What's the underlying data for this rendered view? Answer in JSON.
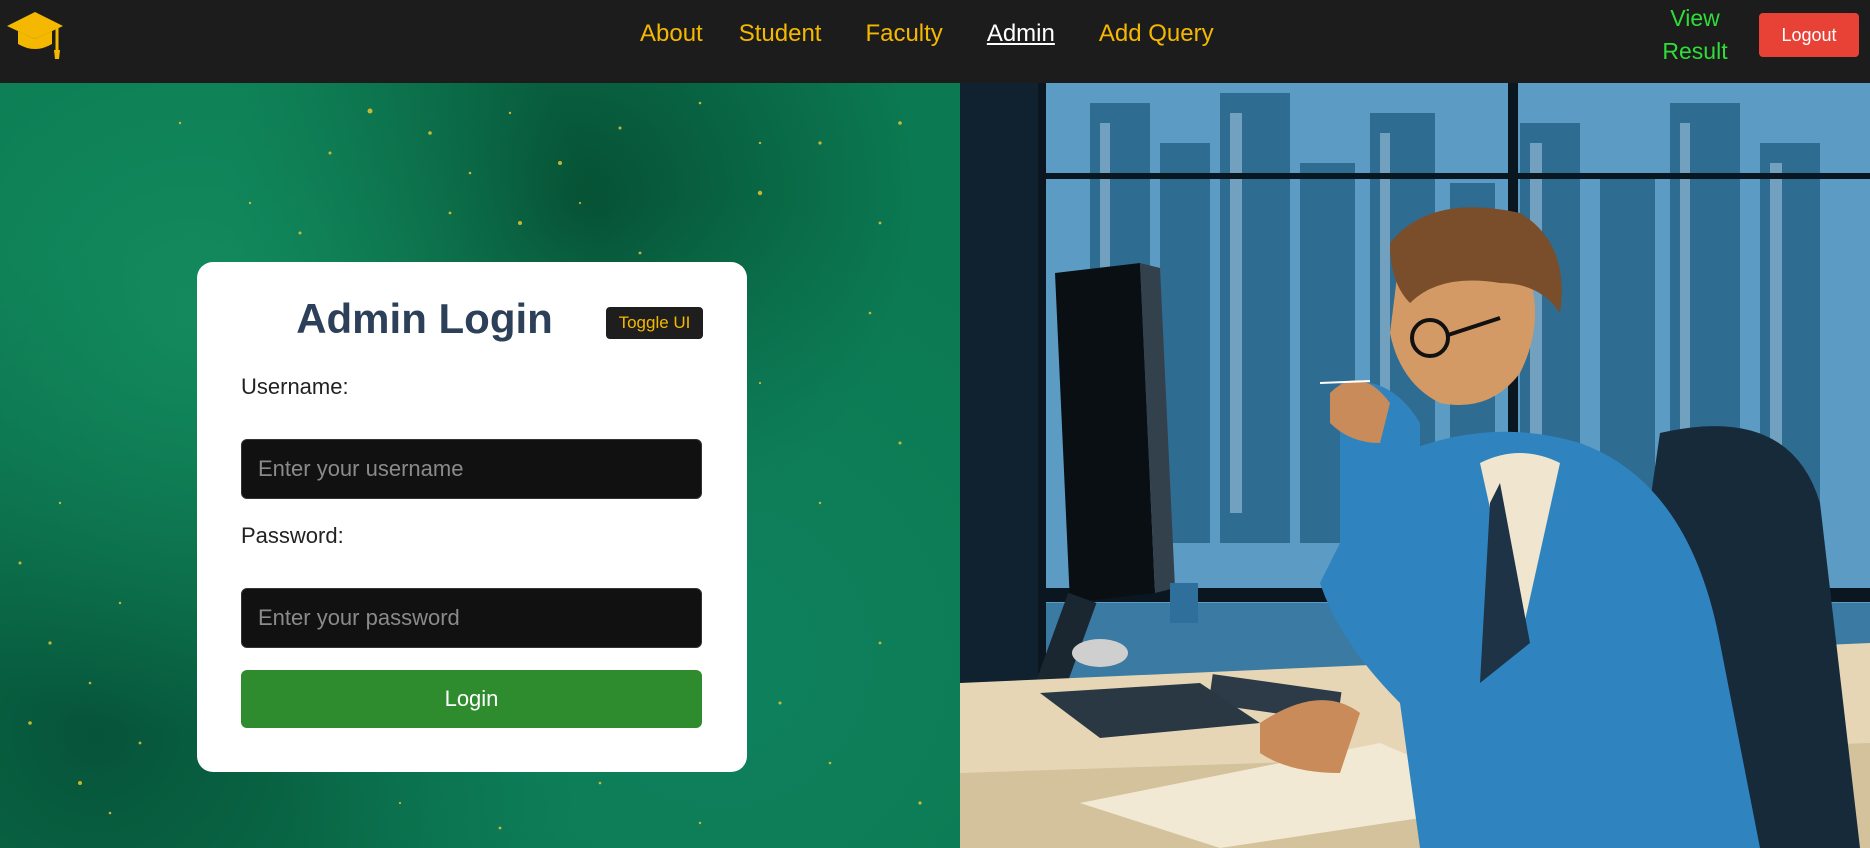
{
  "nav": {
    "links": [
      {
        "label": "About",
        "active": false
      },
      {
        "label": "Student",
        "active": false
      },
      {
        "label": "Faculty",
        "active": false
      },
      {
        "label": "Admin",
        "active": true
      },
      {
        "label": "Add Query",
        "active": false
      }
    ],
    "view_result_line1": "View",
    "view_result_line2": "Result",
    "logout_label": "Logout"
  },
  "login": {
    "title": "Admin Login",
    "toggle_label": "Toggle UI",
    "username_label": "Username:",
    "username_placeholder": "Enter your username",
    "username_value": "",
    "password_label": "Password:",
    "password_placeholder": "Enter your password",
    "password_value": "",
    "submit_label": "Login"
  },
  "colors": {
    "nav_link": "#f5b800",
    "nav_active": "#ffffff",
    "view_result": "#2fdc3a",
    "logout_bg": "#e84236",
    "login_button": "#2e8b2e",
    "title": "#2d4059",
    "background_green": "#0b7a52"
  },
  "icons": {
    "logo": "graduation-cap-icon"
  }
}
